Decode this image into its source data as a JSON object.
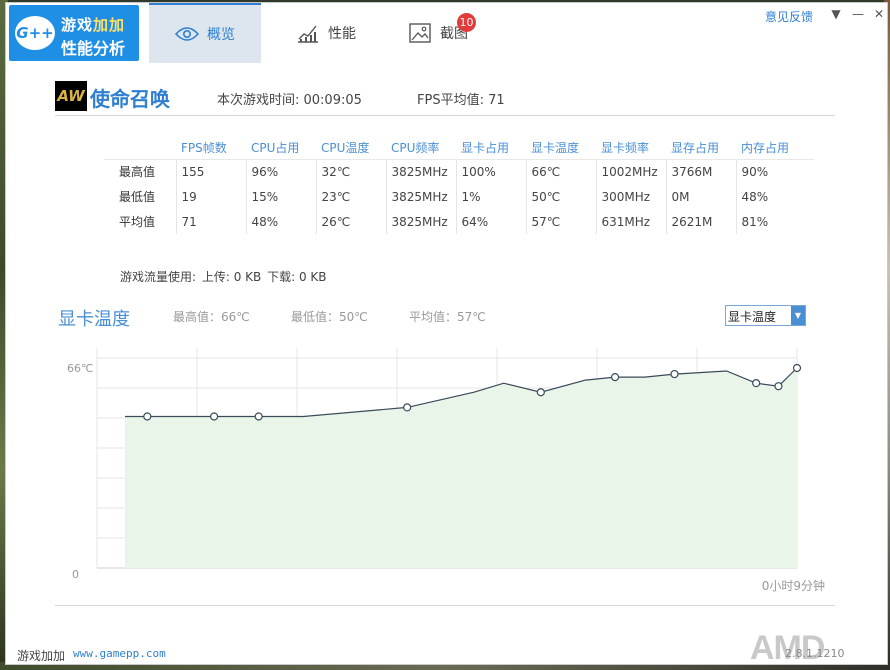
{
  "app": {
    "logo_mark": "G++",
    "logo_line1_a": "游戏",
    "logo_line1_b": "加加",
    "logo_line2": "性能分析"
  },
  "nav": {
    "tabs": [
      {
        "label": "概览",
        "icon": "eye-icon",
        "active": true
      },
      {
        "label": "性能",
        "icon": "line-chart-icon",
        "active": false
      },
      {
        "label": "截图",
        "icon": "picture-icon",
        "active": false
      }
    ],
    "screenshot_badge": "10",
    "feedback": "意见反馈"
  },
  "game": {
    "icon_text": "AW",
    "title": "使命召唤",
    "session_time": "本次游戏时间: 00:09:05",
    "fps_average": "FPS平均值: 71"
  },
  "stats": {
    "headers": [
      "FPS帧数",
      "CPU占用",
      "CPU温度",
      "CPU频率",
      "显卡占用",
      "显卡温度",
      "显卡频率",
      "显存占用",
      "内存占用"
    ],
    "rows": [
      {
        "label": "最高值",
        "values": [
          "155",
          "96%",
          "32℃",
          "3825MHz",
          "100%",
          "66℃",
          "1002MHz",
          "3766M",
          "90%"
        ]
      },
      {
        "label": "最低值",
        "values": [
          "19",
          "15%",
          "23℃",
          "3825MHz",
          "1%",
          "50℃",
          "300MHz",
          "0M",
          "48%"
        ]
      },
      {
        "label": "平均值",
        "values": [
          "71",
          "48%",
          "26℃",
          "3825MHz",
          "64%",
          "57℃",
          "631MHz",
          "2621M",
          "81%"
        ]
      }
    ]
  },
  "traffic": {
    "label": "游戏流量使用:",
    "upload": "上传: 0 KB",
    "download": "下载: 0 KB"
  },
  "chart_section": {
    "title": "显卡温度",
    "max": "最高值：66℃",
    "min": "最低值：50℃",
    "avg": "平均值：57℃",
    "select_value": "显卡温度"
  },
  "chart_data": {
    "type": "area",
    "title": "显卡温度",
    "y_tick_labels": [
      "0",
      "66℃"
    ],
    "ylim": [
      0,
      66
    ],
    "x_end_label": "0小时9分钟",
    "grid": true,
    "x": [
      0,
      0.3,
      1.2,
      1.8,
      2.4,
      3.8,
      4.7,
      5.1,
      5.6,
      6.2,
      6.6,
      7.0,
      7.4,
      8.1,
      8.5,
      8.8,
      9.05
    ],
    "values": [
      50,
      50,
      50,
      50,
      50,
      53,
      58,
      61,
      58,
      62,
      63,
      63,
      64,
      65,
      61,
      60,
      66
    ],
    "markers": [
      1,
      2,
      3,
      5,
      8,
      10,
      12,
      14,
      15,
      16
    ],
    "line_color": "#3a4a5a",
    "fill_color": "#e9f5e9"
  },
  "footer": {
    "brand": "游戏加加",
    "url": "www.gamepp.com",
    "amd": "AMD",
    "version": "2.8.1.1210"
  }
}
